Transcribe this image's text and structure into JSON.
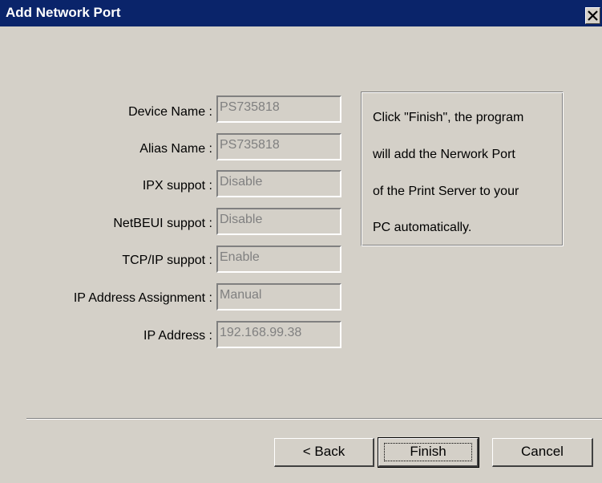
{
  "window": {
    "title": "Add Network Port",
    "close_glyph": "✕"
  },
  "fields": [
    {
      "label": "Device Name :",
      "value": "PS735818"
    },
    {
      "label": "Alias Name :",
      "value": "PS735818"
    },
    {
      "label": "IPX suppot :",
      "value": "Disable"
    },
    {
      "label": "NetBEUI suppot :",
      "value": "Disable"
    },
    {
      "label": "TCP/IP suppot :",
      "value": "Enable"
    },
    {
      "label": "IP Address Assignment :",
      "value": "Manual"
    },
    {
      "label": "IP Address :",
      "value": "192.168.99.38"
    }
  ],
  "info": {
    "lines": [
      "Click \"Finish\", the program",
      "will add the Nerwork Port",
      "of the Print Server to your",
      "PC automatically."
    ]
  },
  "buttons": {
    "back_label": "< Back",
    "finish_label": "Finish",
    "cancel_label": "Cancel"
  },
  "colors": {
    "titlebar": "#0a246a",
    "face": "#d4d0c8",
    "disabled_text": "#808080"
  }
}
